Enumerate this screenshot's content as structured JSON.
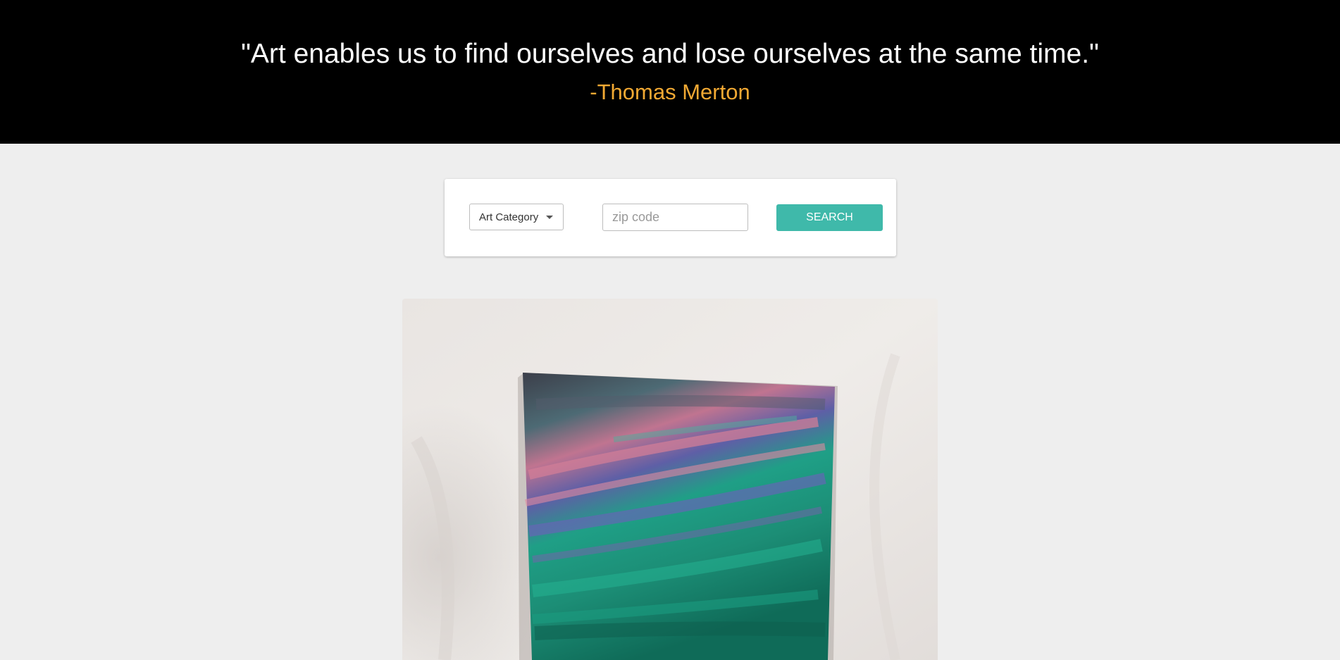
{
  "banner": {
    "quote": "\"Art enables us to find ourselves and lose ourselves at the same time.\"",
    "author": "-Thomas Merton"
  },
  "search": {
    "category_label": "Art Category",
    "zip_placeholder": "zip code",
    "zip_value": "",
    "button_label": "SEARCH"
  },
  "colors": {
    "banner_bg": "#000000",
    "author_accent": "#f2a933",
    "button_bg": "#3fb9aa",
    "page_bg": "#eeeeee"
  },
  "icons": {
    "dropdown": "caret-down-icon"
  }
}
